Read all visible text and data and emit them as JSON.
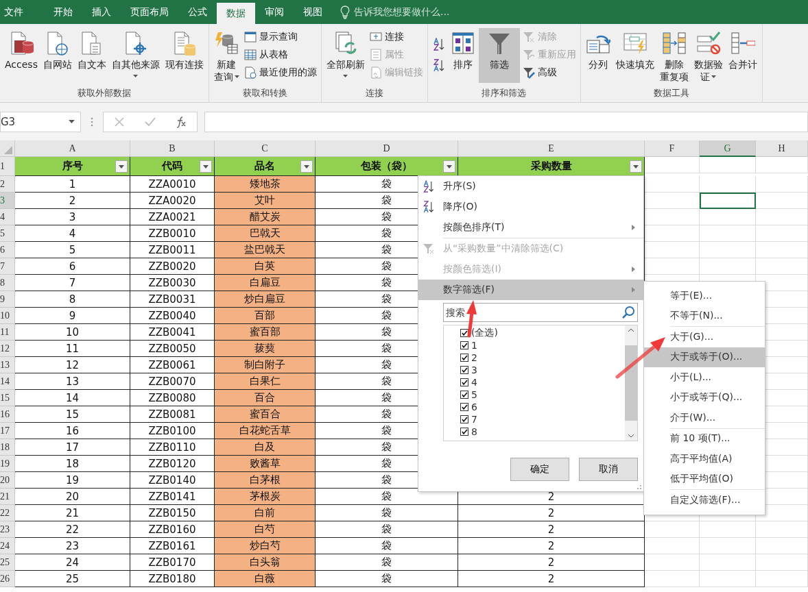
{
  "tabs": [
    {
      "label": "文件",
      "selected": false
    },
    {
      "label": "开始",
      "selected": false
    },
    {
      "label": "插入",
      "selected": false
    },
    {
      "label": "页面布局",
      "selected": false
    },
    {
      "label": "公式",
      "selected": false
    },
    {
      "label": "数据",
      "selected": true
    },
    {
      "label": "审阅",
      "selected": false
    },
    {
      "label": "视图",
      "selected": false
    }
  ],
  "tell_me": "告诉我您想要做什么...",
  "ribbon": {
    "groups": [
      {
        "label": "获取外部数据",
        "items": [
          {
            "kind": "large",
            "lines": [
              "Access"
            ],
            "dropdown": false,
            "pressed": false
          },
          {
            "kind": "large",
            "lines": [
              "自网站"
            ],
            "dropdown": false,
            "pressed": false
          },
          {
            "kind": "large",
            "lines": [
              "自文本"
            ],
            "dropdown": false,
            "pressed": false
          },
          {
            "kind": "large",
            "lines": [
              "自其他来源"
            ],
            "dropdown": true,
            "pressed": false
          },
          {
            "kind": "large",
            "lines": [
              "现有连接"
            ],
            "dropdown": false,
            "pressed": false
          }
        ]
      },
      {
        "label": "获取和转换",
        "items": [
          {
            "kind": "large",
            "lines": [
              "新建",
              "查询"
            ],
            "dropdown": true,
            "pressed": false
          },
          {
            "kind": "stack",
            "items": [
              {
                "label": "显示查询",
                "disabled": false
              },
              {
                "label": "从表格",
                "disabled": false
              },
              {
                "label": "最近使用的源",
                "disabled": false
              }
            ]
          }
        ]
      },
      {
        "label": "连接",
        "items": [
          {
            "kind": "large",
            "lines": [
              "全部刷新"
            ],
            "dropdown": true,
            "pressed": false
          },
          {
            "kind": "stack",
            "items": [
              {
                "label": "连接",
                "disabled": false
              },
              {
                "label": "属性",
                "disabled": true
              },
              {
                "label": "编辑链接",
                "disabled": true
              }
            ]
          }
        ]
      },
      {
        "label": "排序和筛选",
        "items": [
          {
            "kind": "sort"
          },
          {
            "kind": "large",
            "lines": [
              "排序"
            ],
            "dropdown": false,
            "pressed": false
          },
          {
            "kind": "large",
            "lines": [
              "筛选"
            ],
            "dropdown": false,
            "pressed": true
          },
          {
            "kind": "stack",
            "items": [
              {
                "label": "清除",
                "disabled": true
              },
              {
                "label": "重新应用",
                "disabled": true
              },
              {
                "label": "高级",
                "disabled": false
              }
            ]
          }
        ]
      },
      {
        "label": "数据工具",
        "items": [
          {
            "kind": "large",
            "lines": [
              "分列"
            ],
            "dropdown": false,
            "pressed": false
          },
          {
            "kind": "large",
            "lines": [
              "快速填充"
            ],
            "dropdown": false,
            "pressed": false
          },
          {
            "kind": "large",
            "lines": [
              "删除",
              "重复项"
            ],
            "dropdown": false,
            "pressed": false
          },
          {
            "kind": "large",
            "lines": [
              "数据验",
              "证"
            ],
            "dropdown": true,
            "pressed": false
          },
          {
            "kind": "large",
            "lines": [
              "合并计"
            ],
            "dropdown": false,
            "pressed": false
          }
        ]
      }
    ]
  },
  "name_box": "G3",
  "columns": [
    {
      "label": "A",
      "selected": false
    },
    {
      "label": "B",
      "selected": false
    },
    {
      "label": "C",
      "selected": false
    },
    {
      "label": "D",
      "selected": false
    },
    {
      "label": "E",
      "selected": false
    },
    {
      "label": "F",
      "selected": false
    },
    {
      "label": "G",
      "selected": true
    },
    {
      "label": "H",
      "selected": false
    }
  ],
  "rows": [
    {
      "number": "1",
      "kind": "header",
      "selected": false,
      "cells": [
        "序号",
        "代码",
        "品名",
        "包装（袋）",
        "采购数量"
      ]
    },
    {
      "number": "2",
      "selected": false,
      "cells": [
        "1",
        "ZZA0010",
        "矮地茶",
        "袋"
      ]
    },
    {
      "number": "3",
      "selected": true,
      "cells": [
        "2",
        "ZZA0020",
        "艾叶",
        "袋"
      ]
    },
    {
      "number": "4",
      "selected": false,
      "cells": [
        "3",
        "ZZA0021",
        "醋艾炭",
        "袋"
      ]
    },
    {
      "number": "5",
      "selected": false,
      "cells": [
        "4",
        "ZZB0010",
        "巴戟天",
        "袋"
      ]
    },
    {
      "number": "6",
      "selected": false,
      "cells": [
        "5",
        "ZZB0011",
        "盐巴戟天",
        "袋"
      ]
    },
    {
      "number": "7",
      "selected": false,
      "cells": [
        "6",
        "ZZB0020",
        "白英",
        "袋"
      ]
    },
    {
      "number": "8",
      "selected": false,
      "cells": [
        "7",
        "ZZB0030",
        "白扁豆",
        "袋"
      ]
    },
    {
      "number": "9",
      "selected": false,
      "cells": [
        "8",
        "ZZB0031",
        "炒白扁豆",
        "袋"
      ]
    },
    {
      "number": "10",
      "selected": false,
      "cells": [
        "9",
        "ZZB0040",
        "百部",
        "袋"
      ]
    },
    {
      "number": "11",
      "selected": false,
      "cells": [
        "10",
        "ZZB0041",
        "蜜百部",
        "袋"
      ]
    },
    {
      "number": "12",
      "selected": false,
      "cells": [
        "11",
        "ZZB0050",
        "菝葜",
        "袋"
      ]
    },
    {
      "number": "13",
      "selected": false,
      "cells": [
        "12",
        "ZZB0061",
        "制白附子",
        "袋"
      ]
    },
    {
      "number": "14",
      "selected": false,
      "cells": [
        "13",
        "ZZB0070",
        "白果仁",
        "袋"
      ]
    },
    {
      "number": "15",
      "selected": false,
      "cells": [
        "14",
        "ZZB0080",
        "百合",
        "袋"
      ]
    },
    {
      "number": "16",
      "selected": false,
      "cells": [
        "15",
        "ZZB0081",
        "蜜百合",
        "袋"
      ]
    },
    {
      "number": "17",
      "selected": false,
      "cells": [
        "16",
        "ZZB0100",
        "白花蛇舌草",
        "袋"
      ]
    },
    {
      "number": "18",
      "selected": false,
      "cells": [
        "17",
        "ZZB0110",
        "白及",
        "袋"
      ]
    },
    {
      "number": "19",
      "selected": false,
      "cells": [
        "18",
        "ZZB0120",
        "败酱草",
        "袋"
      ]
    },
    {
      "number": "20",
      "selected": false,
      "cells": [
        "19",
        "ZZB0140",
        "白茅根",
        "袋"
      ]
    },
    {
      "number": "21",
      "selected": false,
      "cells": [
        "20",
        "ZZB0141",
        "茅根炭",
        "袋",
        "2"
      ]
    },
    {
      "number": "22",
      "selected": false,
      "cells": [
        "21",
        "ZZB0150",
        "白前",
        "袋",
        "2"
      ]
    },
    {
      "number": "23",
      "selected": false,
      "cells": [
        "22",
        "ZZB0160",
        "白芍",
        "袋",
        "2"
      ]
    },
    {
      "number": "24",
      "selected": false,
      "cells": [
        "23",
        "ZZB0161",
        "炒白芍",
        "袋",
        "2"
      ]
    },
    {
      "number": "25",
      "selected": false,
      "cells": [
        "24",
        "ZZB0170",
        "白头翁",
        "袋",
        "2"
      ]
    },
    {
      "number": "26",
      "selected": false,
      "cells": [
        "25",
        "ZZB0180",
        "白薇",
        "袋",
        "2"
      ]
    }
  ],
  "filter_menu": {
    "items": [
      {
        "kind": "item",
        "label": "升序(S)",
        "disabled": false,
        "submenu": false,
        "highlighted": false
      },
      {
        "kind": "item",
        "label": "降序(O)",
        "disabled": false,
        "submenu": false,
        "highlighted": false
      },
      {
        "kind": "item",
        "label": "按颜色排序(T)",
        "disabled": false,
        "submenu": true,
        "highlighted": false
      },
      {
        "kind": "separator"
      },
      {
        "kind": "item",
        "label": "从“采购数量”中清除筛选(C)",
        "disabled": true,
        "submenu": false,
        "highlighted": false
      },
      {
        "kind": "item",
        "label": "按颜色筛选(I)",
        "disabled": true,
        "submenu": true,
        "highlighted": false
      },
      {
        "kind": "item",
        "label": "数字筛选(F)",
        "disabled": false,
        "submenu": true,
        "highlighted": true
      }
    ],
    "search": {
      "placeholder": "搜索"
    },
    "values": [
      {
        "label": "(全选)",
        "checked": true
      },
      {
        "label": "1",
        "checked": true
      },
      {
        "label": "2",
        "checked": true
      },
      {
        "label": "3",
        "checked": true
      },
      {
        "label": "4",
        "checked": true
      },
      {
        "label": "5",
        "checked": true
      },
      {
        "label": "6",
        "checked": true
      },
      {
        "label": "7",
        "checked": true
      },
      {
        "label": "8",
        "checked": true
      }
    ],
    "buttons": [
      "确定",
      "取消"
    ]
  },
  "number_filter_menu": {
    "items": [
      {
        "kind": "item",
        "label": "等于(E)...",
        "highlighted": false
      },
      {
        "kind": "item",
        "label": "不等于(N)...",
        "highlighted": false
      },
      {
        "kind": "separator"
      },
      {
        "kind": "item",
        "label": "大于(G)...",
        "highlighted": false
      },
      {
        "kind": "item",
        "label": "大于或等于(O)...",
        "highlighted": true
      },
      {
        "kind": "item",
        "label": "小于(L)...",
        "highlighted": false
      },
      {
        "kind": "item",
        "label": "小于或等于(Q)...",
        "highlighted": false
      },
      {
        "kind": "item",
        "label": "介于(W)...",
        "highlighted": false
      },
      {
        "kind": "separator"
      },
      {
        "kind": "item",
        "label": "前 10 项(T)...",
        "highlighted": false
      },
      {
        "kind": "item",
        "label": "高于平均值(A)",
        "highlighted": false
      },
      {
        "kind": "item",
        "label": "低于平均值(O)",
        "highlighted": false
      },
      {
        "kind": "separator"
      },
      {
        "kind": "item",
        "label": "自定义筛选(F)...",
        "highlighted": false
      }
    ]
  }
}
